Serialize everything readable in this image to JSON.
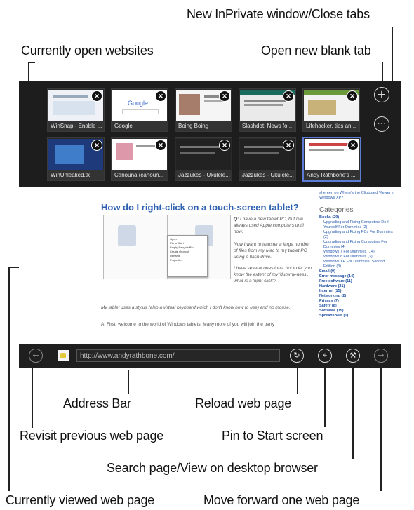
{
  "callouts": {
    "inprivate": "New InPrivate window/Close tabs",
    "open_sites": "Currently open websites",
    "new_tab": "Open new blank tab",
    "address_bar": "Address Bar",
    "reload": "Reload web page",
    "back": "Revisit previous web page",
    "pin": "Pin to Start screen",
    "search_page": "Search page/View on desktop browser",
    "current_page": "Currently viewed web page",
    "forward": "Move forward one web page"
  },
  "tabs": [
    {
      "title": "WinSnap - Enable ..."
    },
    {
      "title": "Google"
    },
    {
      "title": "Boing Boing"
    },
    {
      "title": "Slashdot: News fo..."
    },
    {
      "title": "Lifehacker, tips an..."
    },
    {
      "title": "WinUnleaked.tk"
    },
    {
      "title": "Canouna (canoun..."
    },
    {
      "title": "Jazzukes - Ukulele..."
    },
    {
      "title": "Jazzukes - Ukulele..."
    },
    {
      "title": "Andy Rathbone's ..."
    }
  ],
  "address": {
    "url": "http://www.andyrathbone.com/"
  },
  "page": {
    "title": "How do I right-click on a touch-screen tablet?",
    "q_label": "Q:",
    "q_text": "I have a new tablet PC, but I've always used Apple computers until now.",
    "p2": "Now I want to transfer a large number of files from my Mac to my tablet PC using a flash drive.",
    "p3": "I have several questions, but to let you know the extent of my 'dummy-ness', what is a 'right click'?",
    "p4": "My tablet uses a stylus (also a virtual keyboard which I don't know how to use) and no mouse.",
    "p5": "A: First, welcome to the world of Windows tablets. Many more of you will join the party",
    "menu_items": [
      "Open",
      "Pin to Start",
      "Empty Recycle Bin",
      "Create shortcut",
      "Rename",
      "Properties"
    ],
    "side_top": "shereen on Where's the Clipboard Viewer in Windows XP?",
    "categories_label": "Categories",
    "categories": [
      {
        "text": "Books (29)",
        "bold": true
      },
      {
        "text": "Upgrading and Fixing Computers Do-It-Yourself For Dummies (2)",
        "bold": false
      },
      {
        "text": "Upgrading and Fixing PCs For Dummies (2)",
        "bold": false
      },
      {
        "text": "Upgrading and Fixing Computers For Dummies (4)",
        "bold": false
      },
      {
        "text": "Windows 7 For Dummies (14)",
        "bold": false
      },
      {
        "text": "Windows 8 For Dummies (3)",
        "bold": false
      },
      {
        "text": "Windows XP For Dummies, Second Edition (3)",
        "bold": false
      },
      {
        "text": "Email (9)",
        "bold": true
      },
      {
        "text": "Error message (14)",
        "bold": true
      },
      {
        "text": "Free software (11)",
        "bold": true
      },
      {
        "text": "Hardware (21)",
        "bold": true
      },
      {
        "text": "Internet (15)",
        "bold": true
      },
      {
        "text": "Networking (2)",
        "bold": true
      },
      {
        "text": "Privacy (7)",
        "bold": true
      },
      {
        "text": "Safety (8)",
        "bold": true
      },
      {
        "text": "Software (15)",
        "bold": true
      },
      {
        "text": "Spreadsheet (1)",
        "bold": true
      }
    ]
  },
  "buttons": {
    "new_tab": "+",
    "more": "⋯",
    "back": "←",
    "forward": "→",
    "reload": "↻",
    "pin": "⌖",
    "tools": "⚒",
    "close": "✕"
  },
  "colors": {
    "chrome": "#1d1d1d",
    "selected_tab": "#5b7bd5",
    "link": "#2b5fb0"
  }
}
